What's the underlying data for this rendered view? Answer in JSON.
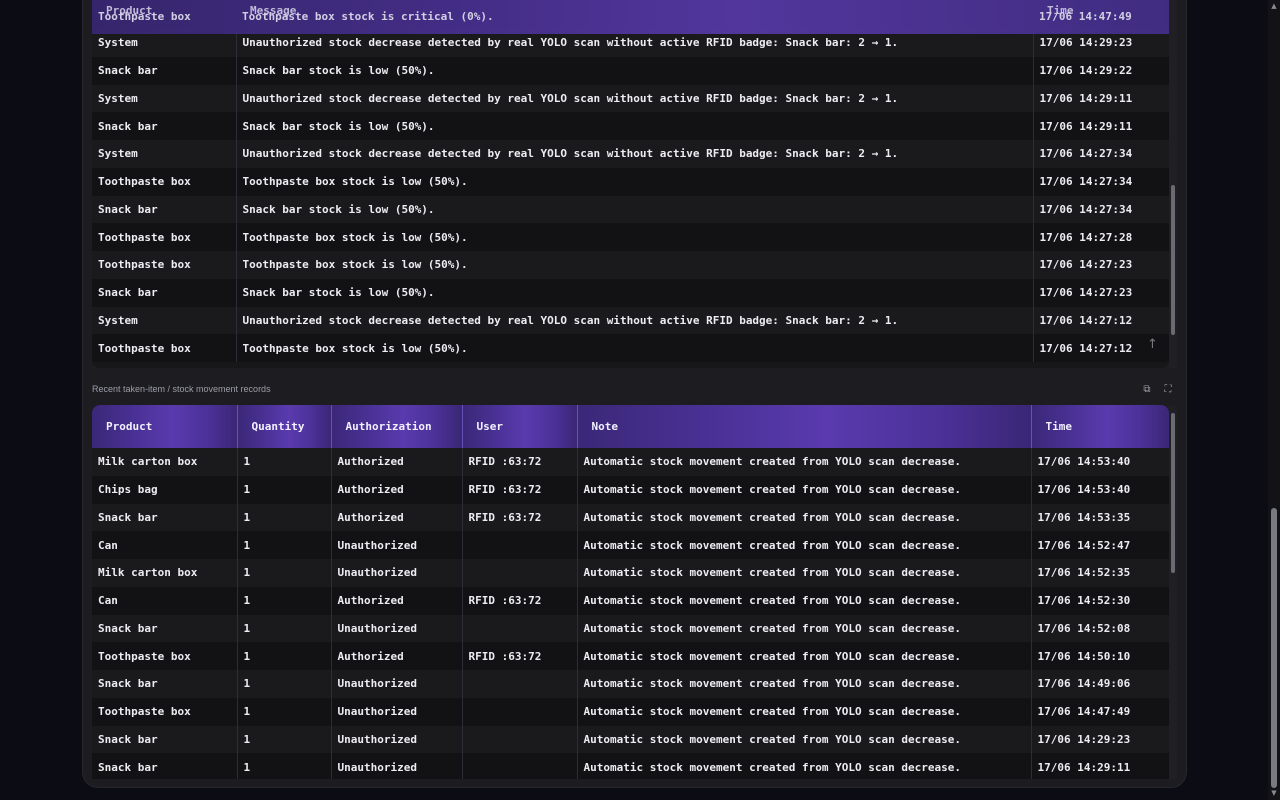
{
  "alerts_table": {
    "columns": [
      "Product",
      "Message",
      "Time"
    ],
    "header_partial_row": {
      "product": "Toothpaste box",
      "message": "Toothpaste box stock is critical (0%).",
      "time": "17/06 14:47:49"
    },
    "rows": [
      {
        "product": "System",
        "message": "Unauthorized stock decrease detected by real YOLO scan without active RFID badge: Snack bar: 2 → 1.",
        "time": "17/06 14:29:23"
      },
      {
        "product": "Snack bar",
        "message": "Snack bar stock is low (50%).",
        "time": "17/06 14:29:22"
      },
      {
        "product": "System",
        "message": "Unauthorized stock decrease detected by real YOLO scan without active RFID badge: Snack bar: 2 → 1.",
        "time": "17/06 14:29:11"
      },
      {
        "product": "Snack bar",
        "message": "Snack bar stock is low (50%).",
        "time": "17/06 14:29:11"
      },
      {
        "product": "System",
        "message": "Unauthorized stock decrease detected by real YOLO scan without active RFID badge: Snack bar: 2 → 1.",
        "time": "17/06 14:27:34"
      },
      {
        "product": "Toothpaste box",
        "message": "Toothpaste box stock is low (50%).",
        "time": "17/06 14:27:34"
      },
      {
        "product": "Snack bar",
        "message": "Snack bar stock is low (50%).",
        "time": "17/06 14:27:34"
      },
      {
        "product": "Toothpaste box",
        "message": "Toothpaste box stock is low (50%).",
        "time": "17/06 14:27:28"
      },
      {
        "product": "Toothpaste box",
        "message": "Toothpaste box stock is low (50%).",
        "time": "17/06 14:27:23"
      },
      {
        "product": "Snack bar",
        "message": "Snack bar stock is low (50%).",
        "time": "17/06 14:27:23"
      },
      {
        "product": "System",
        "message": "Unauthorized stock decrease detected by real YOLO scan without active RFID badge: Snack bar: 2 → 1.",
        "time": "17/06 14:27:12"
      },
      {
        "product": "Toothpaste box",
        "message": "Toothpaste box stock is low (50%).",
        "time": "17/06 14:27:12"
      }
    ]
  },
  "movements_section": {
    "label": "Recent taken-item / stock movement records",
    "copy_icon": "copy-icon",
    "fullscreen_icon": "expand-icon"
  },
  "movements_table": {
    "columns": [
      "Product",
      "Quantity",
      "Authorization",
      "User",
      "Note",
      "Time"
    ],
    "rows": [
      {
        "product": "Milk carton box",
        "quantity": "1",
        "authorization": "Authorized",
        "user": "RFID :63:72",
        "note": "Automatic stock movement created from YOLO scan decrease.",
        "time": "17/06 14:53:40"
      },
      {
        "product": "Chips bag",
        "quantity": "1",
        "authorization": "Authorized",
        "user": "RFID :63:72",
        "note": "Automatic stock movement created from YOLO scan decrease.",
        "time": "17/06 14:53:40"
      },
      {
        "product": "Snack bar",
        "quantity": "1",
        "authorization": "Authorized",
        "user": "RFID :63:72",
        "note": "Automatic stock movement created from YOLO scan decrease.",
        "time": "17/06 14:53:35"
      },
      {
        "product": "Can",
        "quantity": "1",
        "authorization": "Unauthorized",
        "user": "",
        "note": "Automatic stock movement created from YOLO scan decrease.",
        "time": "17/06 14:52:47"
      },
      {
        "product": "Milk carton box",
        "quantity": "1",
        "authorization": "Unauthorized",
        "user": "",
        "note": "Automatic stock movement created from YOLO scan decrease.",
        "time": "17/06 14:52:35"
      },
      {
        "product": "Can",
        "quantity": "1",
        "authorization": "Authorized",
        "user": "RFID :63:72",
        "note": "Automatic stock movement created from YOLO scan decrease.",
        "time": "17/06 14:52:30"
      },
      {
        "product": "Snack bar",
        "quantity": "1",
        "authorization": "Unauthorized",
        "user": "",
        "note": "Automatic stock movement created from YOLO scan decrease.",
        "time": "17/06 14:52:08"
      },
      {
        "product": "Toothpaste box",
        "quantity": "1",
        "authorization": "Authorized",
        "user": "RFID :63:72",
        "note": "Automatic stock movement created from YOLO scan decrease.",
        "time": "17/06 14:50:10"
      },
      {
        "product": "Snack bar",
        "quantity": "1",
        "authorization": "Unauthorized",
        "user": "",
        "note": "Automatic stock movement created from YOLO scan decrease.",
        "time": "17/06 14:49:06"
      },
      {
        "product": "Toothpaste box",
        "quantity": "1",
        "authorization": "Unauthorized",
        "user": "",
        "note": "Automatic stock movement created from YOLO scan decrease.",
        "time": "17/06 14:47:49"
      },
      {
        "product": "Snack bar",
        "quantity": "1",
        "authorization": "Unauthorized",
        "user": "",
        "note": "Automatic stock movement created from YOLO scan decrease.",
        "time": "17/06 14:29:23"
      },
      {
        "product": "Snack bar",
        "quantity": "1",
        "authorization": "Unauthorized",
        "user": "",
        "note": "Automatic stock movement created from YOLO scan decrease.",
        "time": "17/06 14:29:11"
      }
    ]
  },
  "scroll_to_top_icon": "arrow-up-icon",
  "colors": {
    "background": "#0b0c14",
    "panel": "#1c1c21",
    "header_gradient_mid": "#5a3aae",
    "row_odd": "#1a1a1d",
    "row_even": "#121214"
  }
}
